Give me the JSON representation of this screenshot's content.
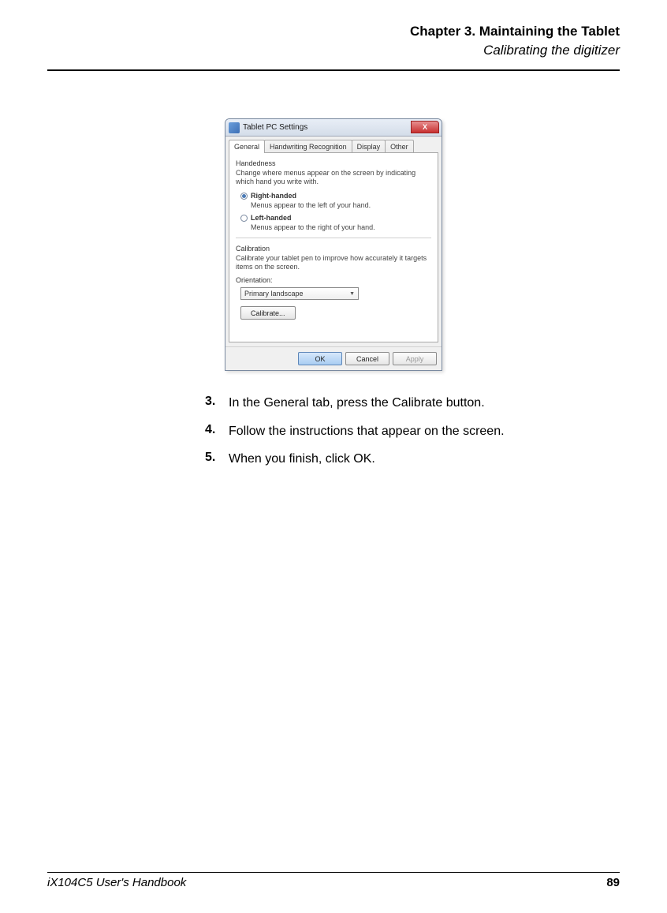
{
  "header": {
    "chapter": "Chapter 3. Maintaining the Tablet",
    "section": "Calibrating the digitizer"
  },
  "dialog": {
    "title": "Tablet PC Settings",
    "close": "X",
    "tabs": {
      "general": "General",
      "handwriting": "Handwriting Recognition",
      "display": "Display",
      "other": "Other"
    },
    "handedness": {
      "label": "Handedness",
      "desc": "Change where menus appear on the screen by indicating which hand you write with.",
      "right": {
        "label": "Right-handed",
        "sub": "Menus appear to the left of your hand."
      },
      "left": {
        "label": "Left-handed",
        "sub": "Menus appear to the right of your hand."
      }
    },
    "calibration": {
      "label": "Calibration",
      "desc": "Calibrate your tablet pen to improve how accurately it targets items on the screen.",
      "orientation_label": "Orientation:",
      "orientation_value": "Primary landscape",
      "button": "Calibrate..."
    },
    "footer": {
      "ok": "OK",
      "cancel": "Cancel",
      "apply": "Apply"
    }
  },
  "steps": {
    "s3": {
      "num": "3.",
      "pre": "In the General tab, press the ",
      "ui": "Calibrate",
      "post": " button."
    },
    "s4": {
      "num": "4.",
      "text": "Follow the instructions that appear on the screen."
    },
    "s5": {
      "num": "5.",
      "pre": "When you finish, click ",
      "ui": "OK",
      "post": "."
    }
  },
  "footer": {
    "left": "iX104C5 User's Handbook",
    "right": "89"
  }
}
